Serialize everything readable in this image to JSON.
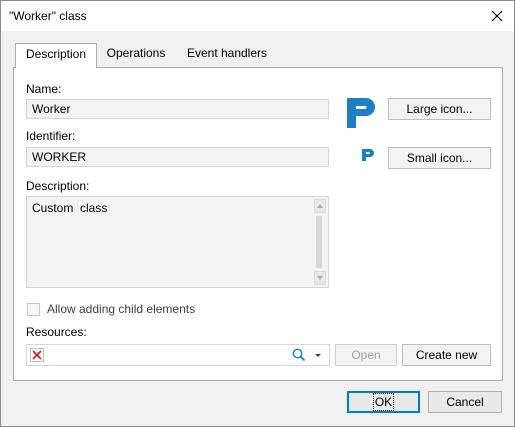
{
  "window": {
    "title": "\"Worker\" class"
  },
  "tabs": [
    {
      "label": "Description",
      "active": true
    },
    {
      "label": "Operations",
      "active": false
    },
    {
      "label": "Event handlers",
      "active": false
    }
  ],
  "form": {
    "name_label": "Name:",
    "name_value": "Worker",
    "identifier_label": "Identifier:",
    "identifier_value": "WORKER",
    "description_label": "Description:",
    "description_value": "Custom  class",
    "large_icon_button": "Large icon...",
    "small_icon_button": "Small icon...",
    "allow_child_label": "Allow adding child elements",
    "allow_child_checked": false,
    "resources_label": "Resources:",
    "resources_value": "",
    "open_button": "Open",
    "create_new_button": "Create new"
  },
  "footer": {
    "ok_label": "OK",
    "cancel_label": "Cancel"
  },
  "colors": {
    "accent": "#0078d7",
    "icon_blue": "#1d7fc4",
    "clear_red": "#e81123"
  },
  "icons": [
    "close-icon",
    "class-large-icon",
    "class-small-icon",
    "clear-icon",
    "search-icon",
    "dropdown-arrow-icon"
  ]
}
